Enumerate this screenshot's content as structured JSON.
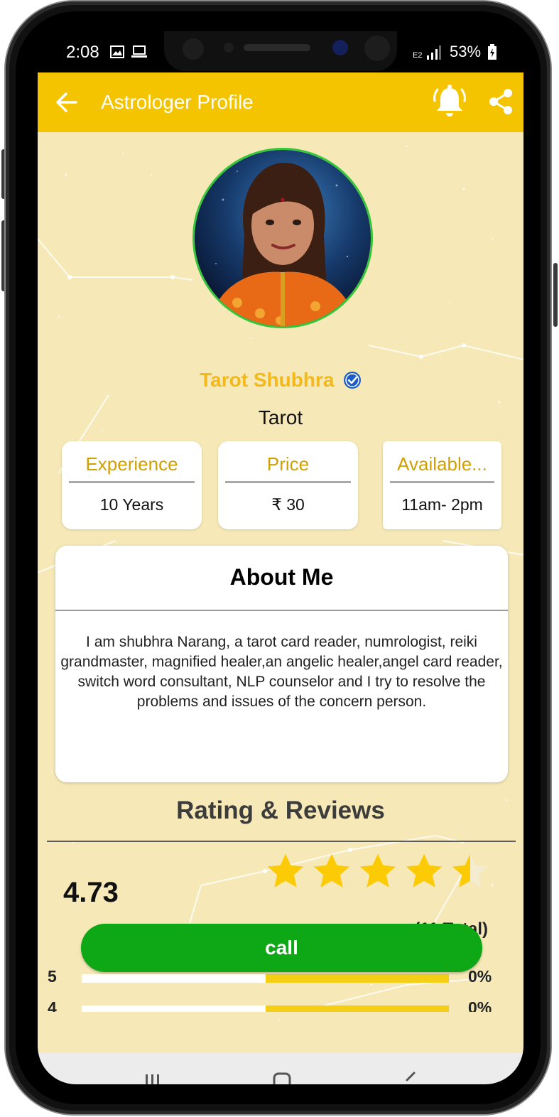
{
  "status_bar": {
    "time": "2:08",
    "network": "E2",
    "battery": "53%"
  },
  "app_bar": {
    "title": "Astrologer Profile",
    "back_icon": "arrow-left-icon",
    "bell_icon": "bell-ring-icon",
    "share_icon": "share-icon"
  },
  "profile": {
    "name": "Tarot Shubhra",
    "verified": true,
    "category": "Tarot"
  },
  "info_cards": [
    {
      "label": "Experience",
      "value": "10 Years"
    },
    {
      "label": "Price",
      "value": "₹ 30"
    },
    {
      "label": "Available...",
      "value": "11am- 2pm"
    }
  ],
  "about": {
    "title": "About Me",
    "body": "I am shubhra Narang, a tarot card reader, numrologist, reiki grandmaster, magnified healer,an angelic healer,angel card reader, switch word consultant, NLP counselor and I try to resolve the problems and issues of the concern person."
  },
  "ratings": {
    "title": "Rating & Reviews",
    "score": "4.73",
    "stars": 4.73,
    "total": "(11 Total)",
    "bars": [
      {
        "label": "5",
        "percent": "0%",
        "fill_fraction": 0.5
      },
      {
        "label": "4",
        "percent": "0%",
        "fill_fraction": 0.5
      }
    ]
  },
  "actions": {
    "call": "call"
  },
  "colors": {
    "accent": "#f5c400",
    "call_green": "#0ea715",
    "name_gold": "#f3b91a",
    "label_gold": "#d2a100",
    "avatar_border": "#36c63a"
  }
}
